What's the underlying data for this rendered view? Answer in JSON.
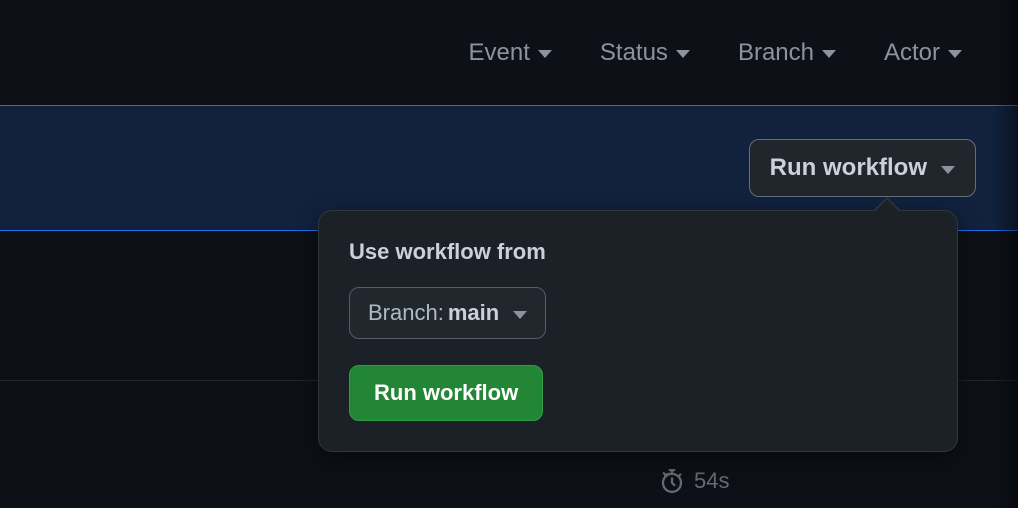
{
  "filters": {
    "event": "Event",
    "status": "Status",
    "branch": "Branch",
    "actor": "Actor"
  },
  "runWorkflowButton": "Run workflow",
  "popover": {
    "title": "Use workflow from",
    "branchPrefix": "Branch: ",
    "branchName": "main",
    "submitLabel": "Run workflow"
  },
  "runDuration": "54s"
}
